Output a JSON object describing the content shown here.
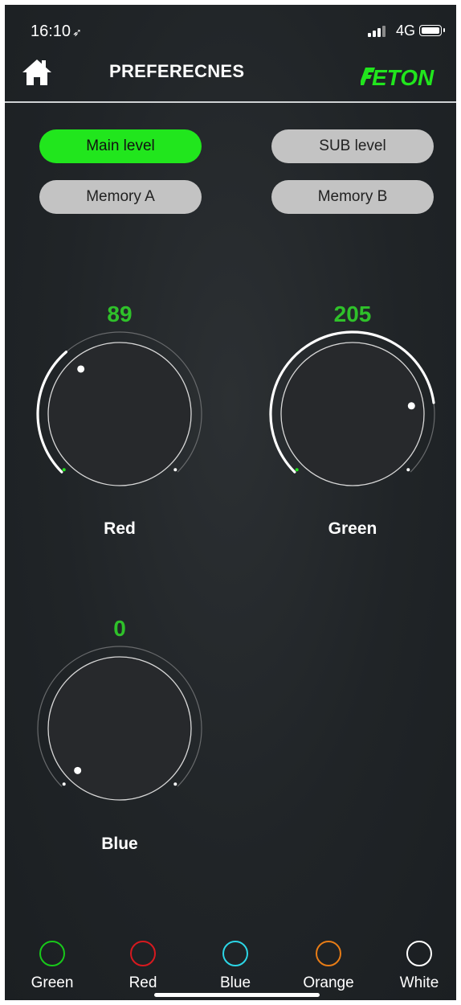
{
  "status": {
    "time": "16:10",
    "network": "4G"
  },
  "header": {
    "title": "PREFERECNES",
    "logo": "ETON"
  },
  "buttons": {
    "main_level": "Main level",
    "sub_level": "SUB level",
    "memory_a": "Memory A",
    "memory_b": "Memory B"
  },
  "knobs": {
    "red": {
      "label": "Red",
      "value": "89",
      "max": 255
    },
    "green": {
      "label": "Green",
      "value": "205",
      "max": 255
    },
    "blue": {
      "label": "Blue",
      "value": "0",
      "max": 255
    }
  },
  "colors": [
    {
      "label": "Green",
      "color": "#18c81a"
    },
    {
      "label": "Red",
      "color": "#d7191f"
    },
    {
      "label": "Blue",
      "color": "#2cd6e6"
    },
    {
      "label": "Orange",
      "color": "#e77c16"
    },
    {
      "label": "White",
      "color": "#ffffff"
    }
  ],
  "theme": {
    "accent": "#21e61d",
    "value_color": "#2fc12a",
    "background": "#222629"
  }
}
